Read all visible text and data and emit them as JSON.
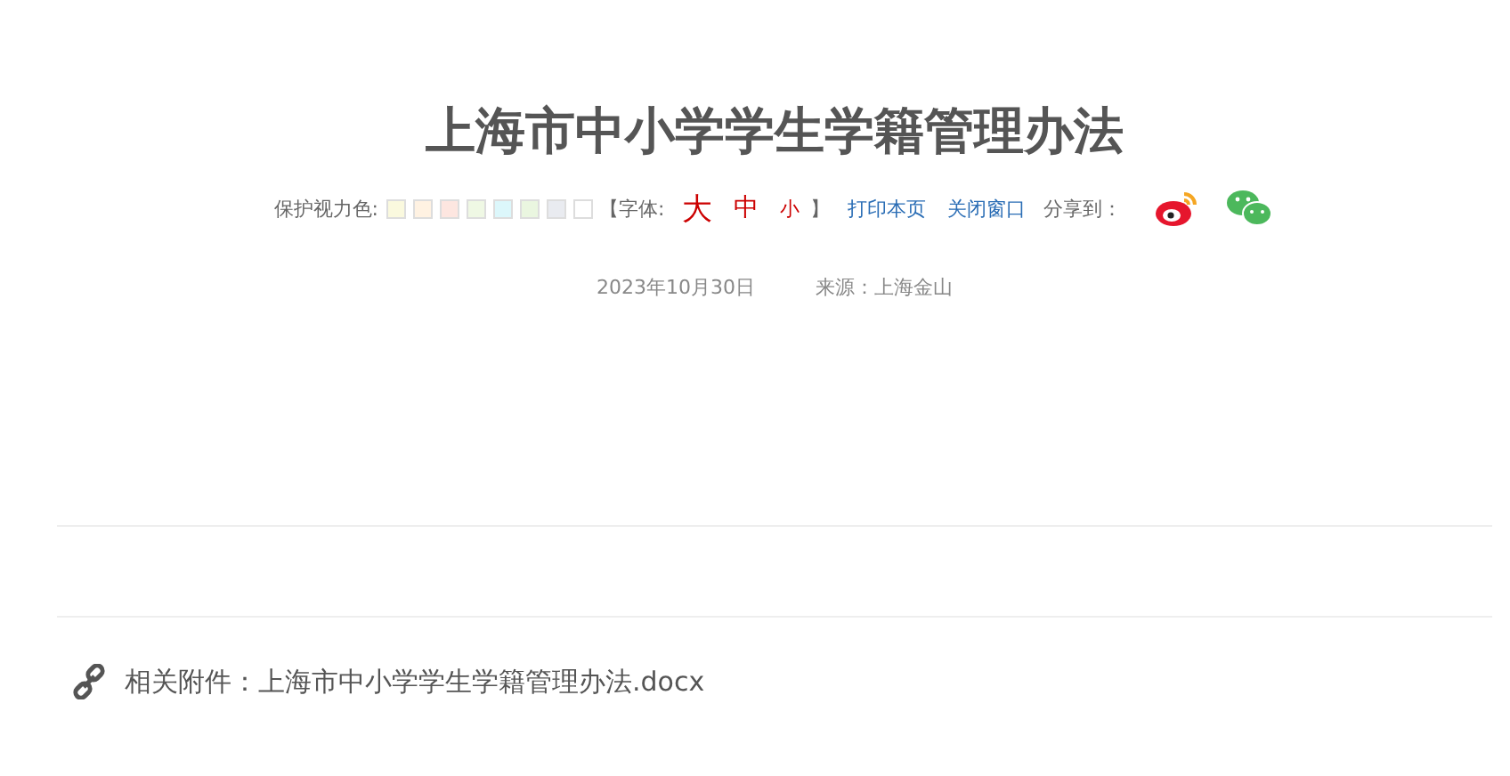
{
  "title": "上海市中小学学生学籍管理办法",
  "toolbar": {
    "eye_care_label": "保护视力色:",
    "swatches": [
      {
        "color": "#faf9de"
      },
      {
        "color": "#fff2e2"
      },
      {
        "color": "#fde6e0"
      },
      {
        "color": "#eff8e4"
      },
      {
        "color": "#dcf7fb"
      },
      {
        "color": "#eaf6e0"
      },
      {
        "color": "#e9ebf0"
      },
      {
        "color": "#ffffff"
      }
    ],
    "font_open": "【字体:",
    "font_sizes": [
      {
        "label": "大",
        "kind": "large"
      },
      {
        "label": "中",
        "kind": "medium"
      },
      {
        "label": "小",
        "kind": "small"
      }
    ],
    "font_close": "】",
    "links": [
      "打印本页",
      "关闭窗口"
    ],
    "share_label": "分享到："
  },
  "meta": {
    "date": "2023年10月30日",
    "source": "来源：上海金山"
  },
  "attachment": "相关附件：上海市中小学学生学籍管理办法.docx"
}
